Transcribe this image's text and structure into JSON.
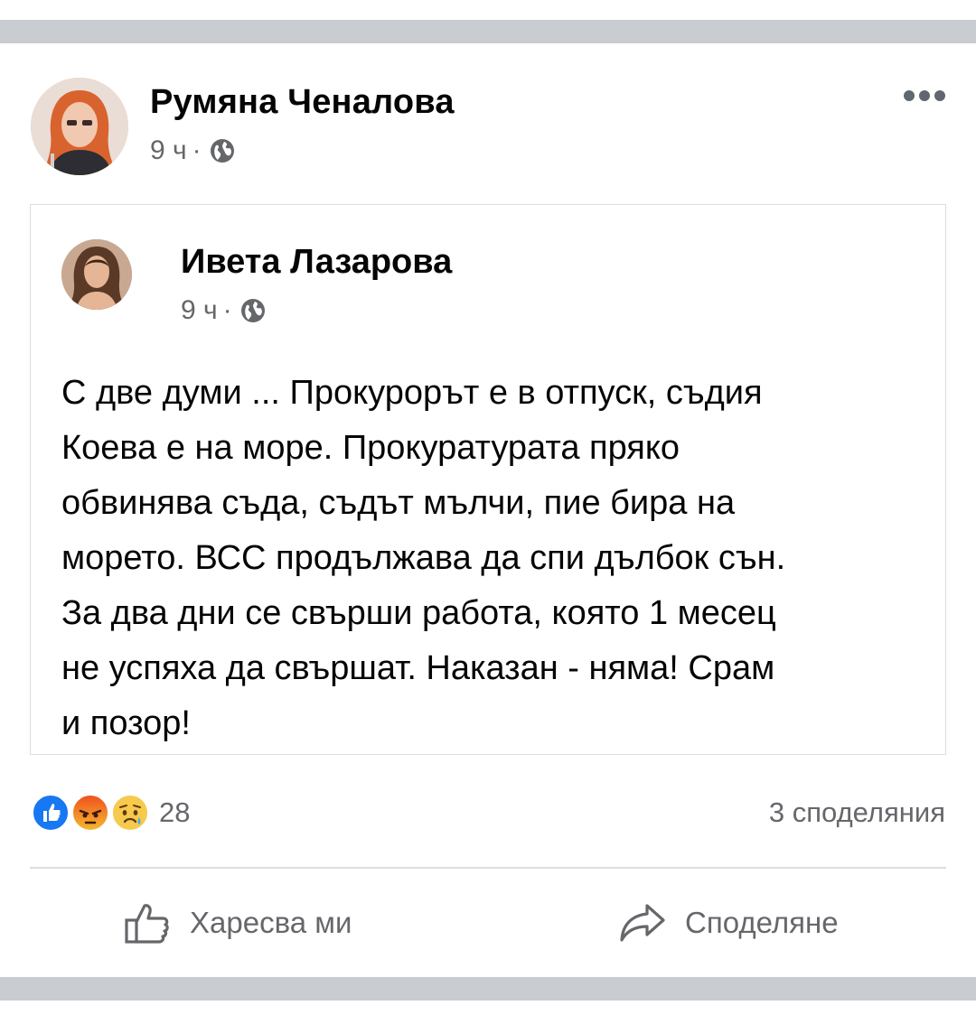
{
  "post": {
    "author": {
      "name": "Румяна Ченалова",
      "time": "9 ч",
      "separator": "·",
      "audience_icon": "globe-icon"
    },
    "more_icon": "more-dots-icon"
  },
  "shared_post": {
    "author": {
      "name": "Ивета Лазарова",
      "time": "9 ч",
      "separator": "·",
      "audience_icon": "globe-icon"
    },
    "text": "С две думи ... Прокурорът е в отпуск, съдия\nКоева е на море. Прокуратурата пряко\nобвинява съда, съдът мълчи, пие бира на\nморето. ВСС продължава да спи дълбок сън.\nЗа два дни се свърши работа, която 1 месец\nне успяха да свършат. Наказан - няма! Срам\nи позор!"
  },
  "reactions": {
    "icons": [
      "like-reaction-icon",
      "angry-reaction-icon",
      "sad-reaction-icon"
    ],
    "count": "28",
    "shares": "3 споделяния"
  },
  "actions": {
    "like_label": "Харесва ми",
    "share_label": "Споделяне"
  },
  "colors": {
    "like_blue": "#1877f2",
    "secondary_text": "#65676b",
    "divider": "#c9ccd1"
  }
}
